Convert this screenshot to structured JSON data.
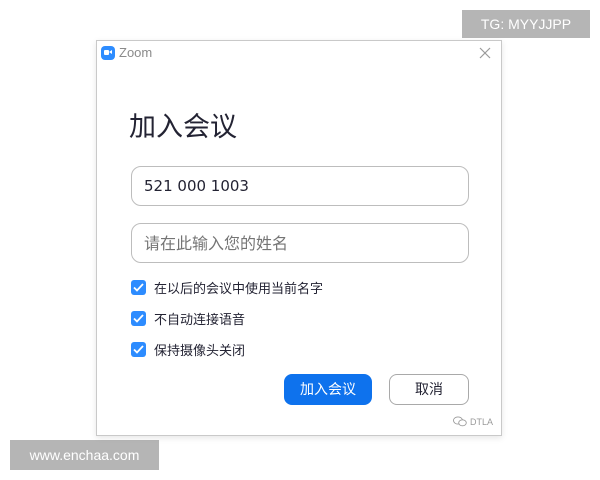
{
  "window": {
    "app_name": "Zoom",
    "heading": "加入会议"
  },
  "form": {
    "meeting_id": "521 000 1003",
    "name_placeholder": "请在此输入您的姓名",
    "options": [
      {
        "label": "在以后的会议中使用当前名字",
        "checked": true
      },
      {
        "label": "不自动连接语音",
        "checked": true
      },
      {
        "label": "保持摄像头关闭",
        "checked": true
      }
    ],
    "join_label": "加入会议",
    "cancel_label": "取消"
  },
  "footer": {
    "mark": "DTLA"
  },
  "overlays": {
    "tg": "TG: MYYJJPP",
    "site": "www.enchaa.com"
  },
  "colors": {
    "accent": "#0e72ed",
    "checkbox": "#2d8cff"
  },
  "icons": [
    "zoom-logo-icon",
    "close-icon",
    "checkmark-icon",
    "wechat-icon"
  ]
}
